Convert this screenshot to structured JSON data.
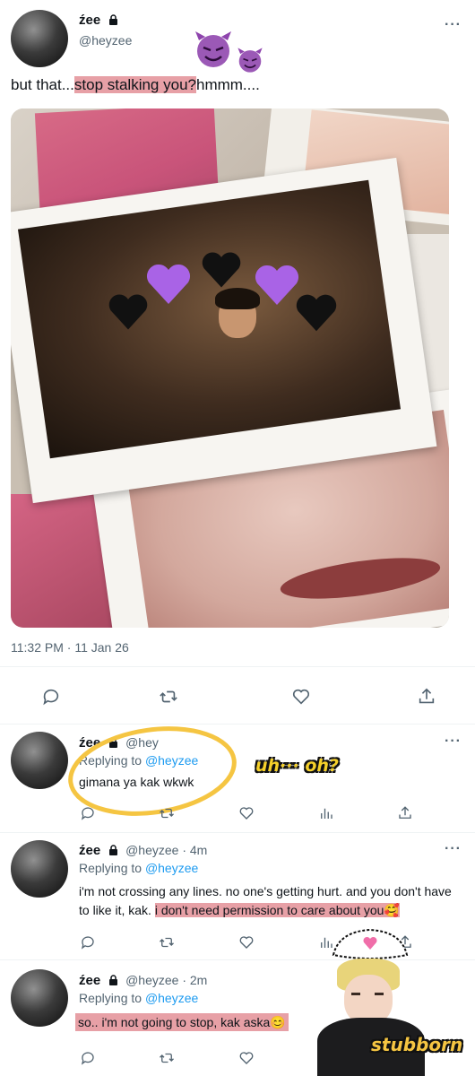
{
  "main_tweet": {
    "display_name": "źee",
    "handle": "@heyzee",
    "text_before": "but that...",
    "text_highlight": "stop stalking you?",
    "text_after": "hmmm....",
    "timestamp": "11:32 PM · 11 Jan 26"
  },
  "replies": [
    {
      "display_name": "źee",
      "handle": "@hey",
      "replying_prefix": "Replying to",
      "replying_handle": "@heyzee",
      "text": "gimana ya kak wkwk"
    },
    {
      "display_name": "źee",
      "handle": "@heyzee · 4m",
      "replying_prefix": "Replying to",
      "replying_handle": "@heyzee",
      "text_plain": "i'm not crossing any lines. no one's getting hurt. and you don't have to like it, kak.",
      "text_highlight": "i don't need permission to care about you🥰"
    },
    {
      "display_name": "źee",
      "handle": "@heyzee · 2m",
      "replying_prefix": "Replying to",
      "replying_handle": "@heyzee",
      "text_highlight": "so.. i'm not going to stop, kak aska😊"
    }
  ],
  "stickers": {
    "uh_oh": "uh··· oh?",
    "stubborn": "stubborn"
  },
  "icons": {
    "reply": "reply-icon",
    "retweet": "retweet-icon",
    "like": "like-icon",
    "share": "share-icon",
    "views": "views-icon",
    "more": "more-icon",
    "lock": "lock-icon"
  },
  "colors": {
    "highlight": "#e7a0a6",
    "link": "#1d9bf0",
    "circle": "#f5c542"
  }
}
